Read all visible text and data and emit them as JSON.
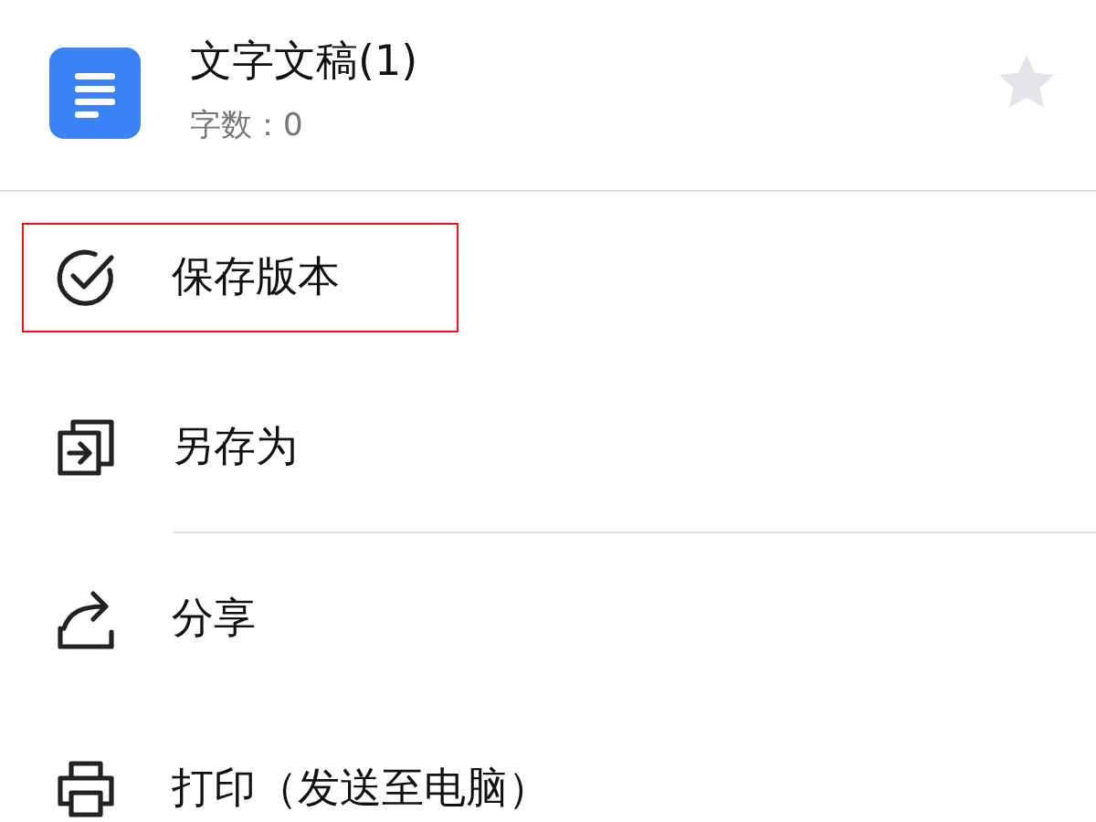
{
  "document": {
    "title": "文字文稿(1)",
    "subtitle": "字数：0",
    "starred": false
  },
  "menu": [
    {
      "kind": "save-version",
      "label": "保存版本",
      "highlighted": true,
      "divider_after": false
    },
    {
      "kind": "save-as",
      "label": "另存为",
      "highlighted": false,
      "divider_after": true
    },
    {
      "kind": "share",
      "label": "分享",
      "highlighted": false,
      "divider_after": false
    },
    {
      "kind": "print",
      "label": "打印（发送至电脑）",
      "highlighted": false,
      "divider_after": false
    }
  ]
}
